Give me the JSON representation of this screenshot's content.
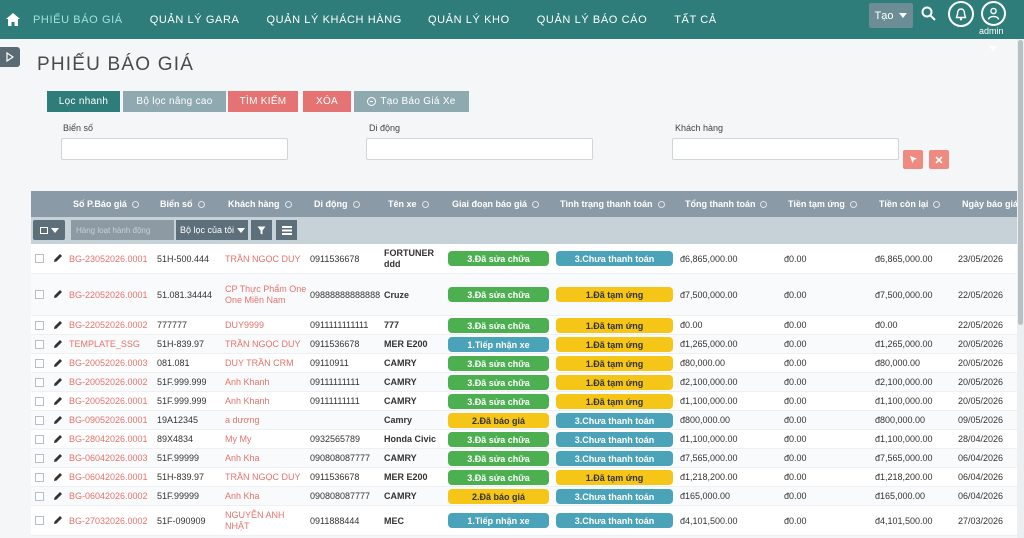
{
  "nav": {
    "items": [
      "PHIẾU BÁO GIÁ",
      "QUẢN LÝ GARA",
      "QUẢN LÝ KHÁCH HÀNG",
      "QUẢN LÝ KHO",
      "QUẢN LÝ BÁO CÁO",
      "TẤT CẢ"
    ],
    "tao": "Tạo",
    "user": "admin"
  },
  "page_title": "PHIẾU BÁO GIÁ",
  "buttons": {
    "quick": "Lọc nhanh",
    "advanced": "Bộ lọc nâng cao",
    "search": "Tìm kiếm",
    "delete": "Xóa",
    "create": "Tạo Báo Giá Xe"
  },
  "filters": {
    "plate_label": "Biển số",
    "phone_label": "Di động",
    "customer_label": "Khách hàng"
  },
  "table": {
    "columns": [
      "Số P.Báo giá",
      "Biển số",
      "Khách hàng",
      "Di động",
      "Tên xe",
      "Giai đoạn báo giá",
      "Tình trạng thanh toán",
      "Tổng thanh toán",
      "Tiền tạm ứng",
      "Tiền còn lại",
      "Ngày báo giá"
    ],
    "bulk_placeholder": "Hàng loạt hành động",
    "my_filter": "Bộ lọc của tôi",
    "rows": [
      {
        "id": "BG-23052026.0001",
        "plate": "51H-500.444",
        "customer": "TRẦN NGỌC DUY",
        "phone": "0911536678",
        "car": "FORTUNER ddd",
        "stage": "3.Đã sửa chữa",
        "pay": "3.Chưa thanh toán",
        "total": "đ6,865,000.00",
        "advance": "đ0.00",
        "remain": "đ6,865,000.00",
        "date": "23/05/2026"
      },
      {
        "id": "BG-22052026.0001",
        "plate": "51.081.34444",
        "customer": "CP Thực Phẩm One One Miền Nam",
        "phone": "09888888888888",
        "car": "Cruze",
        "stage": "3.Đã sửa chữa",
        "pay": "1.Đã tạm ứng",
        "total": "đ7,500,000.00",
        "advance": "đ0.00",
        "remain": "đ7,500,000.00",
        "date": "22/05/2026"
      },
      {
        "id": "BG-22052026.0002",
        "plate": "777777",
        "customer": "DUY9999",
        "phone": "0911111111111",
        "car": "777",
        "stage": "3.Đã sửa chữa",
        "pay": "1.Đã tạm ứng",
        "total": "đ0.00",
        "advance": "đ0.00",
        "remain": "đ0.00",
        "date": "22/05/2026"
      },
      {
        "id": "TEMPLATE_SSG",
        "plate": "51H-839.97",
        "customer": "TRẦN NGỌC DUY",
        "phone": "0911536678",
        "car": "MER E200",
        "stage": "1.Tiếp nhận xe",
        "pay": "1.Đã tạm ứng",
        "total": "đ1,265,000.00",
        "advance": "đ0.00",
        "remain": "đ1,265,000.00",
        "date": "20/05/2026"
      },
      {
        "id": "BG-20052026.0003",
        "plate": "081.081",
        "customer": "DUY TRẦN CRM",
        "phone": "09110911",
        "car": "CAMRY",
        "stage": "3.Đã sửa chữa",
        "pay": "1.Đã tạm ứng",
        "total": "đ80,000.00",
        "advance": "đ0.00",
        "remain": "đ80,000.00",
        "date": "20/05/2026"
      },
      {
        "id": "BG-20052026.0002",
        "plate": "51F.999.999",
        "customer": "Anh Khanh",
        "phone": "09111111111",
        "car": "CAMRY",
        "stage": "3.Đã sửa chữa",
        "pay": "1.Đã tạm ứng",
        "total": "đ2,100,000.00",
        "advance": "đ0.00",
        "remain": "đ2,100,000.00",
        "date": "20/05/2026"
      },
      {
        "id": "BG-20052026.0001",
        "plate": "51F.999.999",
        "customer": "Anh Khanh",
        "phone": "09111111111",
        "car": "CAMRY",
        "stage": "3.Đã sửa chữa",
        "pay": "1.Đã tạm ứng",
        "total": "đ1,100,000.00",
        "advance": "đ0.00",
        "remain": "đ1,100,000.00",
        "date": "20/05/2026"
      },
      {
        "id": "BG-09052026.0001",
        "plate": "19A12345",
        "customer": "a dương",
        "phone": "",
        "car": "Camry",
        "stage": "2.Đã báo giá",
        "pay": "3.Chưa thanh toán",
        "total": "đ800,000.00",
        "advance": "đ0.00",
        "remain": "đ800,000.00",
        "date": "09/05/2026"
      },
      {
        "id": "BG-28042026.0001",
        "plate": "89X4834",
        "customer": "My My",
        "phone": "0932565789",
        "car": "Honda Civic",
        "stage": "3.Đã sửa chữa",
        "pay": "3.Chưa thanh toán",
        "total": "đ1,100,000.00",
        "advance": "đ0.00",
        "remain": "đ1,100,000.00",
        "date": "28/04/2026"
      },
      {
        "id": "BG-06042026.0003",
        "plate": "51F.99999",
        "customer": "Anh Kha",
        "phone": "090808087777",
        "car": "CAMRY",
        "stage": "3.Đã sửa chữa",
        "pay": "3.Chưa thanh toán",
        "total": "đ7,565,000.00",
        "advance": "đ0.00",
        "remain": "đ7,565,000.00",
        "date": "06/04/2026"
      },
      {
        "id": "BG-06042026.0001",
        "plate": "51H-839.97",
        "customer": "TRẦN NGỌC DUY",
        "phone": "0911536678",
        "car": "MER E200",
        "stage": "3.Đã sửa chữa",
        "pay": "1.Đã tạm ứng",
        "total": "đ1,218,200.00",
        "advance": "đ0.00",
        "remain": "đ1,218,200.00",
        "date": "06/04/2026"
      },
      {
        "id": "BG-06042026.0002",
        "plate": "51F.99999",
        "customer": "Anh Kha",
        "phone": "090808087777",
        "car": "CAMRY",
        "stage": "2.Đã báo giá",
        "pay": "3.Chưa thanh toán",
        "total": "đ165,000.00",
        "advance": "đ0.00",
        "remain": "đ165,000.00",
        "date": "06/04/2026"
      },
      {
        "id": "BG-27032026.0002",
        "plate": "51F-090909",
        "customer": "NGUYỄN ANH NHẬT",
        "phone": "0911888444",
        "car": "MEC",
        "stage": "1.Tiếp nhận xe",
        "pay": "3.Chưa thanh toán",
        "total": "đ4,101,500.00",
        "advance": "đ0.00",
        "remain": "đ4,101,500.00",
        "date": "27/03/2026"
      }
    ]
  },
  "colors": {
    "stage_green": "#4caf50",
    "stage_teal": "#4aa3b8",
    "stage_yellow": "#f5c518",
    "pay_yellow": "#f5c518",
    "pay_teal": "#4aa3b8"
  }
}
